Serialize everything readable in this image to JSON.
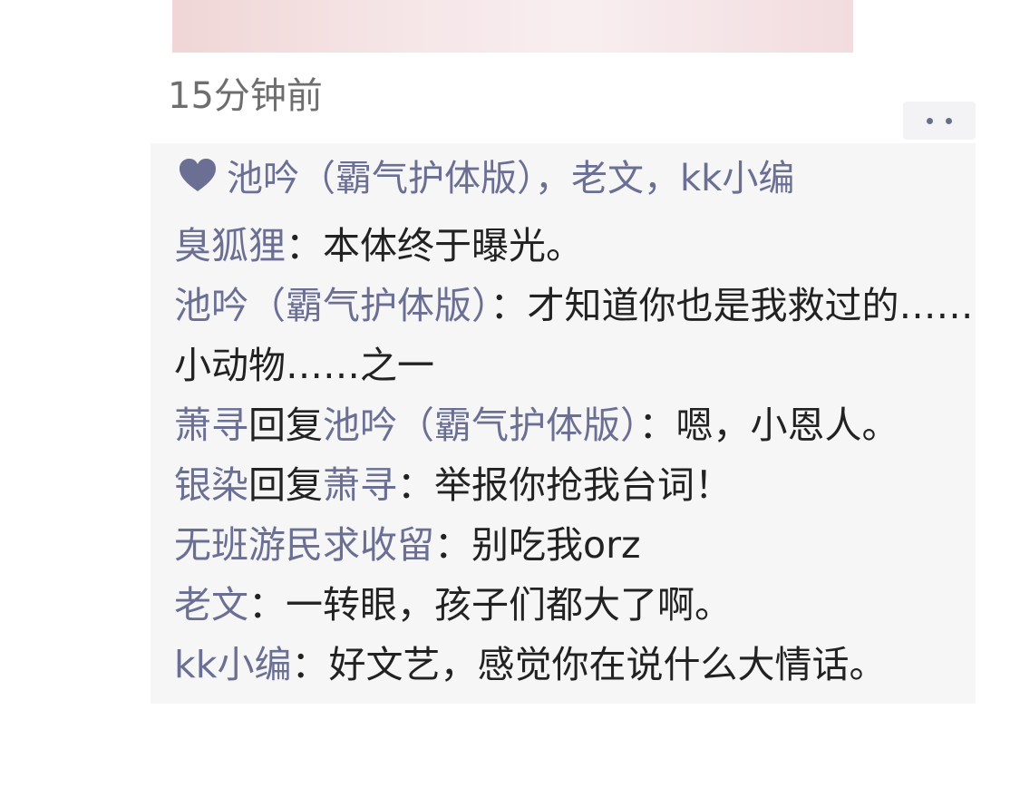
{
  "post": {
    "timestamp": "15分钟前"
  },
  "colors": {
    "name_color": "#6a6f93",
    "text_color": "#222222",
    "panel_bg": "#f6f6f7",
    "timestamp_color": "#6e6e6e"
  },
  "likes": {
    "icon": "heart-icon",
    "text": "池吟（霸气护体版），老文，kk小编"
  },
  "comments": [
    {
      "author": "臭狐狸",
      "reply_word": "",
      "reply_to": "",
      "colon": "：",
      "text": "本体终于曝光。"
    },
    {
      "author": "池吟（霸气护体版）",
      "reply_word": "",
      "reply_to": "",
      "colon": "：",
      "text": "才知道你也是我救过的……小动物……之一"
    },
    {
      "author": "萧寻",
      "reply_word": "回复",
      "reply_to": "池吟（霸气护体版）",
      "colon": "：",
      "text": "嗯，小恩人。"
    },
    {
      "author": "银染",
      "reply_word": "回复",
      "reply_to": "萧寻",
      "colon": "：",
      "text": "举报你抢我台词！"
    },
    {
      "author": "无班游民求收留",
      "reply_word": "",
      "reply_to": "",
      "colon": "：",
      "text": "别吃我orz"
    },
    {
      "author": "老文",
      "reply_word": "",
      "reply_to": "",
      "colon": "：",
      "text": "一转眼，孩子们都大了啊。"
    },
    {
      "author": "kk小编",
      "reply_word": "",
      "reply_to": "",
      "colon": "：",
      "text": "好文艺，感觉你在说什么大情话。"
    }
  ]
}
